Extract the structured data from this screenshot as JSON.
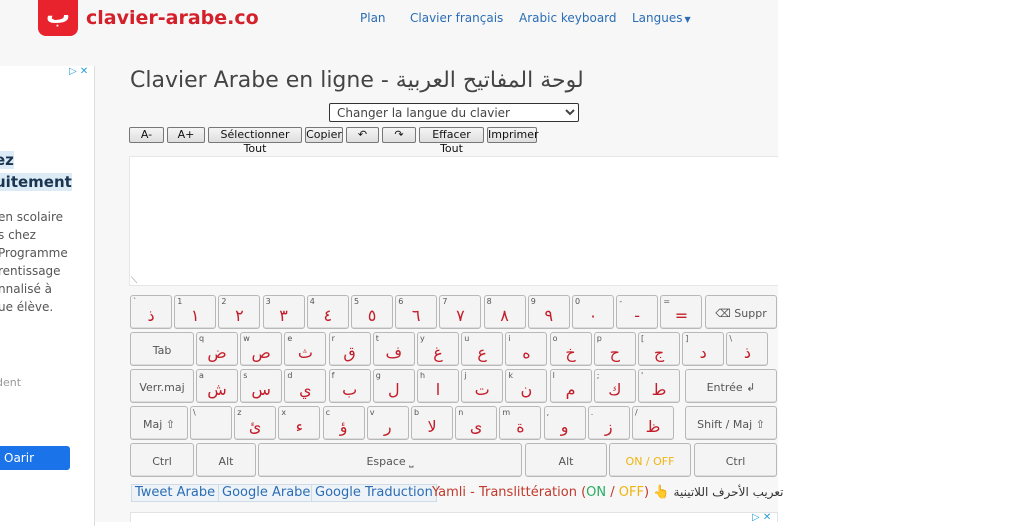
{
  "header": {
    "logo_glyph": "ب",
    "site_name": "clavier-arabe.co",
    "nav": [
      "Plan",
      "Clavier français",
      "Arabic keyboard",
      "Langues"
    ]
  },
  "ad_left": {
    "choices": "▷ ✕",
    "heading_lines": [
      "ez",
      "uitement"
    ],
    "body_lines": [
      "en scolaire",
      "s chez",
      "Programme",
      "rentissage",
      "nnalisé à",
      "ue élève."
    ],
    "small": "dent",
    "button": "Oarir"
  },
  "main": {
    "title": "Clavier Arabe en ligne - لوحة المفاتيح العربية",
    "language_select": "Changer la langue du clavier",
    "toolbar": [
      "A-",
      "A+",
      "Sélectionner Tout",
      "Copier",
      "↶",
      "↷",
      "Effacer Tout",
      "Imprimer"
    ]
  },
  "keyboard": {
    "row1": [
      {
        "up": "`",
        "ar": "ذ"
      },
      {
        "up": "1",
        "ar": "١"
      },
      {
        "up": "2",
        "ar": "٢"
      },
      {
        "up": "3",
        "ar": "٣"
      },
      {
        "up": "4",
        "ar": "٤"
      },
      {
        "up": "5",
        "ar": "٥"
      },
      {
        "up": "6",
        "ar": "٦"
      },
      {
        "up": "7",
        "ar": "٧"
      },
      {
        "up": "8",
        "ar": "٨"
      },
      {
        "up": "9",
        "ar": "٩"
      },
      {
        "up": "0",
        "ar": "٠"
      },
      {
        "up": "-",
        "ar": "-"
      },
      {
        "up": "=",
        "ar": "="
      }
    ],
    "backspace": "⌫ Suppr",
    "tab": "Tab",
    "row2": [
      {
        "up": "q",
        "ar": "ض"
      },
      {
        "up": "w",
        "ar": "ص"
      },
      {
        "up": "e",
        "ar": "ث"
      },
      {
        "up": "r",
        "ar": "ق"
      },
      {
        "up": "t",
        "ar": "ف"
      },
      {
        "up": "y",
        "ar": "غ"
      },
      {
        "up": "u",
        "ar": "ع"
      },
      {
        "up": "i",
        "ar": "ه"
      },
      {
        "up": "o",
        "ar": "خ"
      },
      {
        "up": "p",
        "ar": "ح"
      },
      {
        "up": "[",
        "ar": "ج"
      },
      {
        "up": "]",
        "ar": "د"
      },
      {
        "up": "\\",
        "ar": "ذ"
      }
    ],
    "capslock": "Verr.maj",
    "row3": [
      {
        "up": "a",
        "ar": "ش"
      },
      {
        "up": "s",
        "ar": "س"
      },
      {
        "up": "d",
        "ar": "ي"
      },
      {
        "up": "f",
        "ar": "ب"
      },
      {
        "up": "g",
        "ar": "ل"
      },
      {
        "up": "h",
        "ar": "ا"
      },
      {
        "up": "j",
        "ar": "ت"
      },
      {
        "up": "k",
        "ar": "ن"
      },
      {
        "up": "l",
        "ar": "م"
      },
      {
        "up": ";",
        "ar": "ك"
      },
      {
        "up": "'",
        "ar": "ط"
      }
    ],
    "enter": "Entrée ↲",
    "shift_left": "Maj ⇧",
    "row4": [
      {
        "up": "\\",
        "ar": ""
      },
      {
        "up": "z",
        "ar": "ئ"
      },
      {
        "up": "x",
        "ar": "ء"
      },
      {
        "up": "c",
        "ar": "ؤ"
      },
      {
        "up": "v",
        "ar": "ر"
      },
      {
        "up": "b",
        "ar": "لا"
      },
      {
        "up": "n",
        "ar": "ى"
      },
      {
        "up": "m",
        "ar": "ة"
      },
      {
        "up": ",",
        "ar": "و"
      },
      {
        "up": ".",
        "ar": "ز"
      },
      {
        "up": "/",
        "ar": "ظ"
      }
    ],
    "shift_right": "Shift / Maj ⇧",
    "row5": {
      "ctrl_left": "Ctrl",
      "alt_left": "Alt",
      "space": "Espace ⎵",
      "alt_right": "Alt",
      "onoff": "ON / OFF",
      "ctrl_right": "Ctrl"
    },
    "onoff_color": "#f1b40f"
  },
  "links": {
    "tweet": "Tweet Arabe",
    "google_arabe": "Google Arabe",
    "google_traduction": "Google Traduction",
    "yamli_prefix": "Yamli - Translittération (",
    "yamli_on": "ON",
    "yamli_sep": " / ",
    "yamli_off": "OFF",
    "yamli_suffix": ")",
    "hand": "👆",
    "arabic_note": "تعريب الأحرف اللاتينية"
  },
  "colors": {
    "brand": "#d4202a",
    "link": "#2a6db5",
    "arabic_key": "#c41d2a"
  }
}
